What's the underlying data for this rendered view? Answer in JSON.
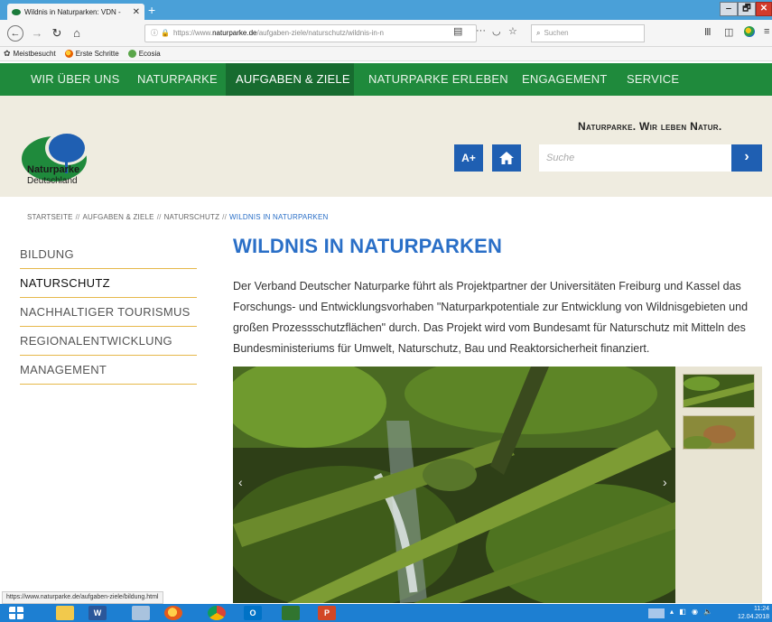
{
  "browser": {
    "tab_title": "Wildnis in Naturparken: VDN - ",
    "tab_close": "✕",
    "new_tab": "+",
    "url": {
      "protocol": "https://www.",
      "host": "naturparke.de",
      "path": "/aufgaben-ziele/naturschutz/wildnis-in-n"
    },
    "search_placeholder": "Suchen",
    "bookmarks": [
      {
        "label": "Meistbesucht",
        "icon": "gear-icon"
      },
      {
        "label": "Erste Schritte",
        "icon": "firefox-icon"
      },
      {
        "label": "Ecosia",
        "icon": "ecosia-icon"
      }
    ],
    "window_controls": {
      "minimize": "‒",
      "maximize": "🗗",
      "close": "✕"
    }
  },
  "site_nav": [
    {
      "label": "WIR ÜBER UNS",
      "active": false
    },
    {
      "label": "NATURPARKE",
      "active": false
    },
    {
      "label": "AUFGABEN & ZIELE",
      "active": true
    },
    {
      "label": "NATURPARKE ERLEBEN",
      "active": false
    },
    {
      "label": "ENGAGEMENT",
      "active": false
    },
    {
      "label": "SERVICE",
      "active": false
    }
  ],
  "header": {
    "logo_title": "Naturparke",
    "logo_subtitle": "Deutschland",
    "slogan": "Naturparke. Wir leben Natur.",
    "font_size_button": "A+",
    "search_placeholder": "Suche",
    "search_button": "›"
  },
  "breadcrumb": [
    "STARTSEITE",
    "AUFGABEN & ZIELE",
    "NATURSCHUTZ",
    "WILDNIS IN NATURPARKEN"
  ],
  "breadcrumb_sep": "//",
  "sidebar": [
    {
      "label": "BILDUNG",
      "active": false
    },
    {
      "label": "NATURSCHUTZ",
      "active": true
    },
    {
      "label": "NACHHALTIGER TOURISMUS",
      "active": false
    },
    {
      "label": "REGIONALENTWICKLUNG",
      "active": false
    },
    {
      "label": "MANAGEMENT",
      "active": false
    }
  ],
  "main": {
    "title": "WILDNIS IN NATURPARKEN",
    "intro": "Der Verband Deutscher Naturparke führt als Projektpartner der Universitäten Freiburg und Kassel das Forschungs- und Entwicklungsvorhaben \"Naturparkpotentiale zur Entwicklung von Wildnisgebieten und großen Prozessschutzflächen\" durch. Das Projekt wird vom Bundesamt für Naturschutz mit Mitteln des Bundesministeriums für Umwelt, Naturschutz, Bau und Reaktorsicherheit finanziert."
  },
  "status_url": "https://www.naturparke.de/aufgaben-ziele/bildung.html",
  "taskbar": {
    "word_label": "W",
    "outlook_label": "O",
    "ppt_label": "P",
    "clock_time": "11:24",
    "clock_date": "12.04.2018"
  },
  "colors": {
    "nav_green": "#1f8a3c",
    "nav_active": "#176b2f",
    "header_bg": "#efece0",
    "accent_blue": "#1f5fb2",
    "title_blue": "#2a6fc7",
    "sidebar_rule": "#e6b84a"
  }
}
